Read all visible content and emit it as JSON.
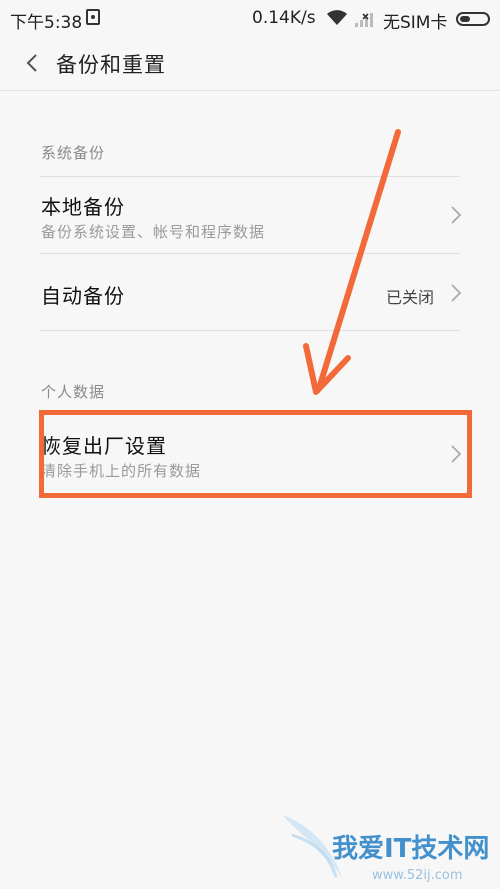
{
  "status_bar": {
    "time": "下午5:38",
    "speed": "0.14K/s",
    "carrier": "无SIM卡",
    "icons": [
      "notification-icon",
      "wifi-icon",
      "signal-icon",
      "battery-icon"
    ]
  },
  "header": {
    "back_icon": "chevron-left-icon",
    "title": "备份和重置"
  },
  "sections": {
    "system_backup": {
      "label": "系统备份",
      "items": [
        {
          "title": "本地备份",
          "subtitle": "备份系统设置、帐号和程序数据"
        },
        {
          "title": "自动备份",
          "value": "已关闭"
        }
      ]
    },
    "personal_data": {
      "label": "个人数据",
      "items": [
        {
          "title": "恢复出厂设置",
          "subtitle": "清除手机上的所有数据"
        }
      ]
    }
  },
  "annotation": {
    "color": "#f26a3a"
  },
  "watermark": {
    "text": "我爱IT技术网",
    "url": "www.52ij.com"
  }
}
